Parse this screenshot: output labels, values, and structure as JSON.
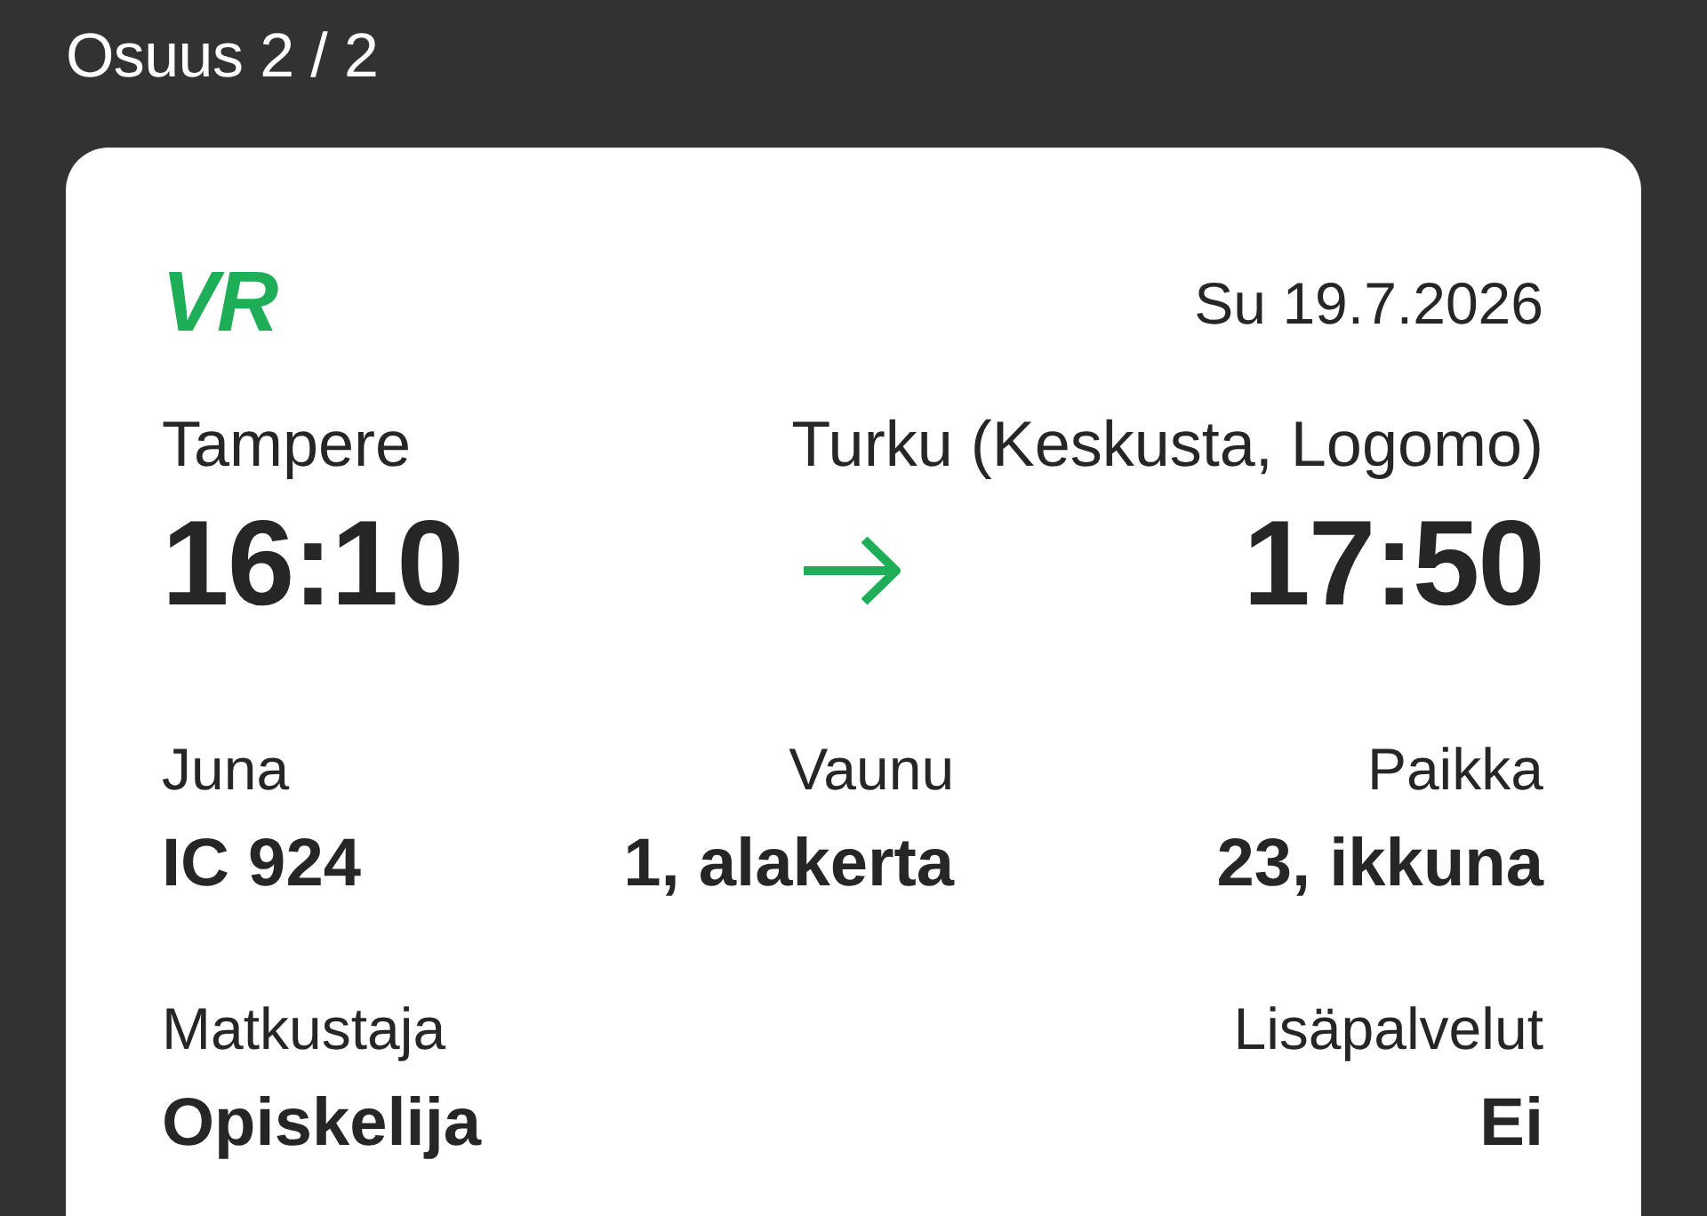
{
  "header": {
    "title": "Osuus 2 / 2"
  },
  "ticket": {
    "logo": "VR",
    "date": "Su 19.7.2026",
    "departure": {
      "station": "Tampere",
      "time": "16:10"
    },
    "arrival": {
      "station": "Turku (Keskusta, Logomo)",
      "time": "17:50"
    },
    "detail_rows": [
      [
        {
          "label": "Juna",
          "value": "IC 924"
        },
        {
          "label": "Vaunu",
          "value": "1, alakerta"
        },
        {
          "label": "Paikka",
          "value": "23, ikkuna"
        }
      ],
      [
        {
          "label": "Matkustaja",
          "value": "Opiskelija"
        },
        {
          "label": "Lisäpalvelut",
          "value": "Ei"
        }
      ]
    ]
  }
}
